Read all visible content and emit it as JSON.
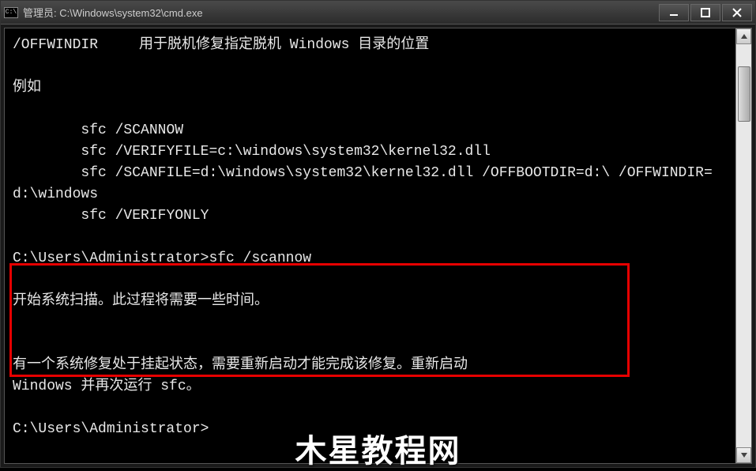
{
  "window": {
    "icon_text": "C:\\",
    "title": "管理员: C:\\Windows\\system32\\cmd.exe"
  },
  "terminal": {
    "option_name": "/OFFWINDIR",
    "option_desc": "用于脱机修复指定脱机 Windows 目录的位置",
    "example_label": "例如",
    "example_lines": [
      "        sfc /SCANNOW",
      "        sfc /VERIFYFILE=c:\\windows\\system32\\kernel32.dll",
      "        sfc /SCANFILE=d:\\windows\\system32\\kernel32.dll /OFFBOOTDIR=d:\\ /OFFWINDIR=d:\\windows",
      "        sfc /VERIFYONLY"
    ],
    "prompt1": "C:\\Users\\Administrator>",
    "command1": "sfc /scannow",
    "scan_msg": "开始系统扫描。此过程将需要一些时间。",
    "pending_msg1": "有一个系统修复处于挂起状态，需要重新启动才能完成该修复。重新启动",
    "pending_msg2": "Windows 并再次运行 sfc。",
    "prompt2": "C:\\Users\\Administrator>"
  },
  "watermark": "木星教程网"
}
